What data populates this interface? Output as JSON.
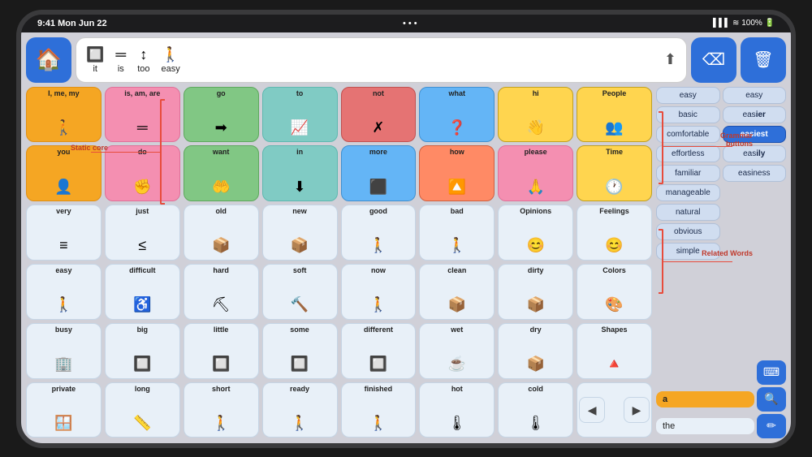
{
  "statusBar": {
    "time": "9:41 Mon Jun 22",
    "dots": "• • •",
    "signal": "▌▌▌▌",
    "wifi": "wifi",
    "battery": "100%"
  },
  "topBar": {
    "homeIcon": "🏠",
    "sentenceWords": [
      {
        "icon": "🔲",
        "text": "it"
      },
      {
        "icon": "═",
        "text": "is"
      },
      {
        "icon": "↕",
        "text": "too"
      },
      {
        "icon": "🚶",
        "text": "easy"
      }
    ],
    "shareIcon": "⬆",
    "backspaceIcon": "⌫",
    "trashIcon": "🗑"
  },
  "annotations": {
    "staticCore": "Static core",
    "grammarButtons": "Grammar\nbuttons",
    "relatedWords": "Related Words"
  },
  "coreWords": [
    [
      {
        "text": "I, me, my",
        "icon": "🚶",
        "color": "core-orange"
      },
      {
        "text": "is, am, are",
        "icon": "═",
        "color": "core-pink"
      },
      {
        "text": "go",
        "icon": "→",
        "color": "core-green"
      },
      {
        "text": "to",
        "icon": "📈",
        "color": "core-teal"
      },
      {
        "text": "not",
        "icon": "✗",
        "color": "core-red"
      },
      {
        "text": "what",
        "icon": "❓",
        "color": "core-blue"
      },
      {
        "text": "hi",
        "icon": "👋",
        "color": "core-yellow"
      },
      {
        "text": "People",
        "icon": "👥",
        "color": "core-yellow"
      }
    ],
    [
      {
        "text": "you",
        "icon": "👤",
        "color": "core-orange"
      },
      {
        "text": "do",
        "icon": "✊",
        "color": "core-pink"
      },
      {
        "text": "want",
        "icon": "🤲",
        "color": "core-green"
      },
      {
        "text": "in",
        "icon": "⬇",
        "color": "core-teal"
      },
      {
        "text": "more",
        "icon": "🔷",
        "color": "core-blue"
      },
      {
        "text": "how",
        "icon": "🔼",
        "color": "core-salmon"
      },
      {
        "text": "please",
        "icon": "🙏",
        "color": "core-pink"
      },
      {
        "text": "Time",
        "icon": "🕐",
        "color": "core-yellow"
      }
    ]
  ],
  "wordGrid": [
    [
      {
        "text": "very",
        "icon": "≡"
      },
      {
        "text": "just",
        "icon": "≤"
      },
      {
        "text": "old",
        "icon": "📦"
      },
      {
        "text": "new",
        "icon": "📦"
      },
      {
        "text": "good",
        "icon": "🚶"
      },
      {
        "text": "bad",
        "icon": "🚶"
      },
      {
        "text": "Opinions",
        "icon": "😊"
      },
      {
        "text": "Feelings",
        "icon": "😊"
      }
    ],
    [
      {
        "text": "easy",
        "icon": "🚶"
      },
      {
        "text": "difficult",
        "icon": "♿"
      },
      {
        "text": "hard",
        "icon": "⛰"
      },
      {
        "text": "soft",
        "icon": "🔨"
      },
      {
        "text": "now",
        "icon": "🚶"
      },
      {
        "text": "clean",
        "icon": "📦"
      },
      {
        "text": "dirty",
        "icon": "📦"
      },
      {
        "text": "Colors",
        "icon": "🎨"
      }
    ],
    [
      {
        "text": "busy",
        "icon": "🏢"
      },
      {
        "text": "big",
        "icon": "🔲"
      },
      {
        "text": "little",
        "icon": "🔲"
      },
      {
        "text": "some",
        "icon": "🔲"
      },
      {
        "text": "different",
        "icon": "🔲"
      },
      {
        "text": "wet",
        "icon": "☕"
      },
      {
        "text": "dry",
        "icon": "📦"
      },
      {
        "text": "Shapes",
        "icon": "🔺"
      }
    ],
    [
      {
        "text": "private",
        "icon": "🪟"
      },
      {
        "text": "long",
        "icon": "📏"
      },
      {
        "text": "short",
        "icon": "🚶"
      },
      {
        "text": "ready",
        "icon": "🚶"
      },
      {
        "text": "finished",
        "icon": "🚶"
      },
      {
        "text": "hot",
        "icon": "🌡"
      },
      {
        "text": "cold",
        "icon": "🌡"
      }
    ]
  ],
  "grammarButtons": {
    "col1": [
      "easy",
      "basic",
      "comfortable",
      "effortless",
      "familiar",
      "manageable",
      "natural",
      "obvious",
      "simple"
    ],
    "col2": [
      "easy",
      "easier",
      "easiest",
      "easily",
      "easiness"
    ]
  },
  "highlightedGrammar": "easiest",
  "relatedWords": [
    "comfortable",
    "effortless",
    "familiar",
    "manageable",
    "natural",
    "obvious",
    "simple"
  ],
  "bottomInputs": {
    "input1": "a",
    "input2": "the"
  }
}
